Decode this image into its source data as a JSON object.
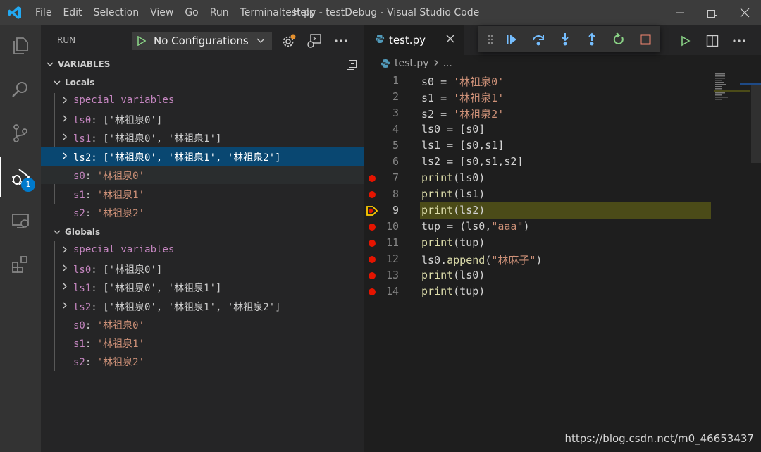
{
  "titlebar": {
    "menu": [
      "File",
      "Edit",
      "Selection",
      "View",
      "Go",
      "Run",
      "Terminal",
      "Help"
    ],
    "title": "test.py - testDebug - Visual Studio Code"
  },
  "activity_badge": "1",
  "sidebar": {
    "run_label": "RUN",
    "config_selected": "No Configurations",
    "variables_header": "VARIABLES",
    "locals": {
      "label": "Locals",
      "special": "special variables",
      "rows": [
        {
          "name": "ls0",
          "value": "['林祖泉0']"
        },
        {
          "name": "ls1",
          "value": "['林祖泉0', '林祖泉1']"
        },
        {
          "name": "ls2",
          "value": "['林祖泉0', '林祖泉1', '林祖泉2']"
        },
        {
          "name": "s0",
          "value": "'林祖泉0'"
        },
        {
          "name": "s1",
          "value": "'林祖泉1'"
        },
        {
          "name": "s2",
          "value": "'林祖泉2'"
        }
      ]
    },
    "globals": {
      "label": "Globals",
      "special": "special variables",
      "rows": [
        {
          "name": "ls0",
          "value": "['林祖泉0']"
        },
        {
          "name": "ls1",
          "value": "['林祖泉0', '林祖泉1']"
        },
        {
          "name": "ls2",
          "value": "['林祖泉0', '林祖泉1', '林祖泉2']"
        },
        {
          "name": "s0",
          "value": "'林祖泉0'"
        },
        {
          "name": "s1",
          "value": "'林祖泉1'"
        },
        {
          "name": "s2",
          "value": "'林祖泉2'"
        }
      ]
    }
  },
  "editor": {
    "tab_name": "test.py",
    "breadcrumb_file": "test.py",
    "breadcrumb_rest": "...",
    "current_line": 9,
    "lines": [
      {
        "n": "1",
        "bp": false,
        "tokens": [
          [
            "id",
            "s0 = "
          ],
          [
            "str",
            "'林祖泉0'"
          ]
        ]
      },
      {
        "n": "2",
        "bp": false,
        "tokens": [
          [
            "id",
            "s1 = "
          ],
          [
            "str",
            "'林祖泉1'"
          ]
        ]
      },
      {
        "n": "3",
        "bp": false,
        "tokens": [
          [
            "id",
            "s2 = "
          ],
          [
            "str",
            "'林祖泉2'"
          ]
        ]
      },
      {
        "n": "4",
        "bp": false,
        "tokens": [
          [
            "id",
            "ls0 = [s0]"
          ]
        ]
      },
      {
        "n": "5",
        "bp": false,
        "tokens": [
          [
            "id",
            "ls1 = [s0,s1]"
          ]
        ]
      },
      {
        "n": "6",
        "bp": false,
        "tokens": [
          [
            "id",
            "ls2 = [s0,s1,s2]"
          ]
        ]
      },
      {
        "n": "7",
        "bp": true,
        "tokens": [
          [
            "fn",
            "print"
          ],
          [
            "id",
            "(ls0)"
          ]
        ]
      },
      {
        "n": "8",
        "bp": true,
        "tokens": [
          [
            "fn",
            "print"
          ],
          [
            "id",
            "(ls1)"
          ]
        ]
      },
      {
        "n": "9",
        "bp": true,
        "tokens": [
          [
            "fn",
            "print"
          ],
          [
            "id",
            "(ls2)"
          ]
        ]
      },
      {
        "n": "10",
        "bp": true,
        "tokens": [
          [
            "id",
            "tup = (ls0,"
          ],
          [
            "str",
            "\"aaa\""
          ],
          [
            "id",
            ")"
          ]
        ]
      },
      {
        "n": "11",
        "bp": true,
        "tokens": [
          [
            "fn",
            "print"
          ],
          [
            "id",
            "(tup)"
          ]
        ]
      },
      {
        "n": "12",
        "bp": true,
        "tokens": [
          [
            "id",
            "ls0."
          ],
          [
            "fn",
            "append"
          ],
          [
            "id",
            "("
          ],
          [
            "str",
            "\"林麻子\""
          ],
          [
            "id",
            ")"
          ]
        ]
      },
      {
        "n": "13",
        "bp": true,
        "tokens": [
          [
            "fn",
            "print"
          ],
          [
            "id",
            "(ls0)"
          ]
        ]
      },
      {
        "n": "14",
        "bp": true,
        "tokens": [
          [
            "fn",
            "print"
          ],
          [
            "id",
            "(tup)"
          ]
        ]
      }
    ]
  },
  "watermark": "https://blog.csdn.net/m0_46653437",
  "colors": {
    "accent": "#007acc",
    "breakpoint": "#e51400",
    "current_line_bg": "#4b4b18",
    "selected_row": "#094771"
  }
}
